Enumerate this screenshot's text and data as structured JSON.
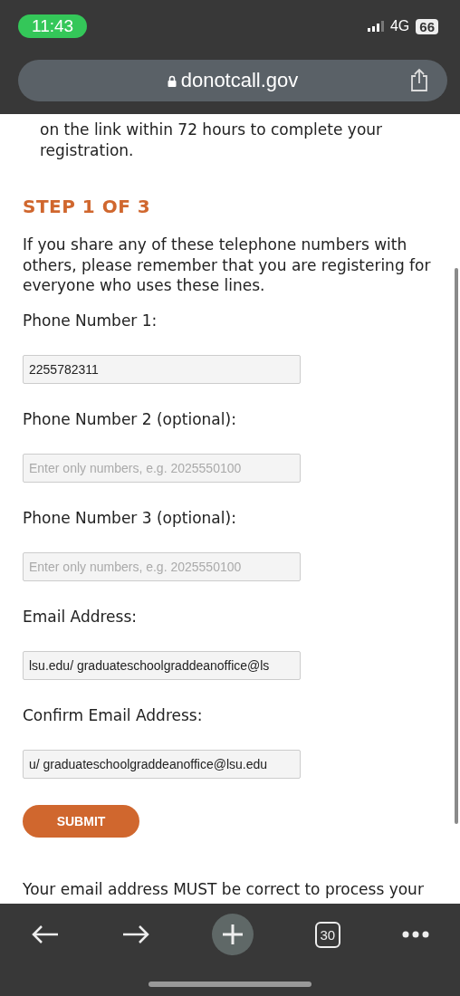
{
  "status_bar": {
    "time": "11:43",
    "network": "4G",
    "battery": "66"
  },
  "address_bar": {
    "url": "donotcall.gov"
  },
  "intro_text": "on the link within 72 hours to complete your registration.",
  "step_heading": "STEP 1 OF 3",
  "instructions": "If you share any of these telephone numbers with others, please remember that you are registering for everyone who uses these lines.",
  "fields": [
    {
      "label": "Phone Number 1:",
      "value": "2255782311"
    },
    {
      "label": "Phone Number 2 (optional):",
      "placeholder": "Enter only numbers, e.g. 2025550100"
    },
    {
      "label": "Phone Number 3 (optional):",
      "placeholder": "Enter only numbers, e.g. 2025550100"
    },
    {
      "label": "Email Address:",
      "value": "lsu.edu/ graduateschoolgraddeanoffice@ls"
    },
    {
      "label": "Confirm Email Address:",
      "value": "u/ graduateschoolgraddeanoffice@lsu.edu"
    }
  ],
  "submit_button": "SUBMIT",
  "notice": "Your email address MUST be correct to process your",
  "toolbar": {
    "tab_count": "30"
  }
}
